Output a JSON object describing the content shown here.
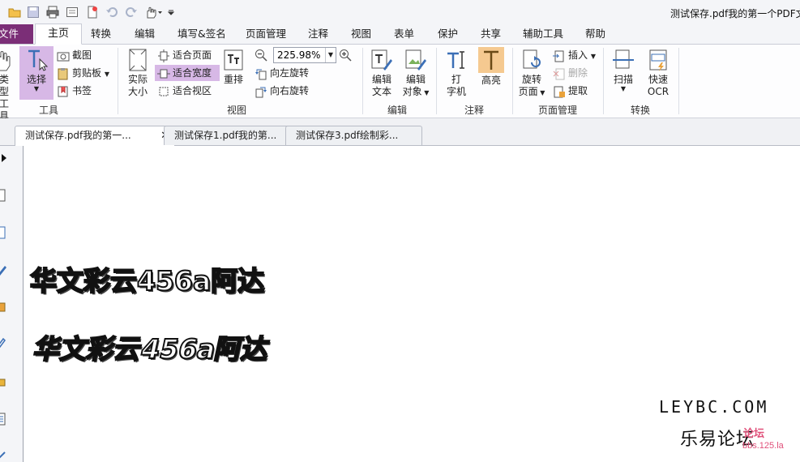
{
  "window": {
    "title": "测试保存.pdf我的第一个PDF文"
  },
  "ribbon_tabs": [
    "文件",
    "主页",
    "转换",
    "编辑",
    "填写&签名",
    "页面管理",
    "注释",
    "视图",
    "表单",
    "保护",
    "共享",
    "辅助工具",
    "帮助"
  ],
  "groups": {
    "tools": {
      "label": "工具",
      "hand_label": [
        "类型",
        "工具"
      ],
      "select_label": "选择",
      "screenshot": "截图",
      "clipboard": "剪贴板",
      "bookmark": "书签"
    },
    "view": {
      "label": "视图",
      "actual_size": [
        "实际",
        "大小"
      ],
      "fit_page": "适合页面",
      "fit_width": "适合宽度",
      "fit_visible": "适合视区",
      "reflow": "重排",
      "zoom_value": "225.98%",
      "rotate_left": "向左旋转",
      "rotate_right": "向右旋转"
    },
    "edit": {
      "label": "编辑",
      "edit_text": [
        "编辑",
        "文本"
      ],
      "edit_object": [
        "编辑",
        "对象"
      ]
    },
    "comment": {
      "label": "注释",
      "typewriter": [
        "打",
        "字机"
      ],
      "highlight": "高亮"
    },
    "page_manage": {
      "label": "页面管理",
      "rotate_page": [
        "旋转",
        "页面"
      ],
      "insert": "插入",
      "delete": "删除",
      "extract": "提取"
    },
    "convert": {
      "label": "转换",
      "scan": "扫描",
      "quick_ocr": [
        "快速",
        "OCR"
      ]
    }
  },
  "doc_tabs": [
    "测试保存.pdf我的第一...",
    "测试保存1.pdf我的第...",
    "测试保存3.pdf绘制彩..."
  ],
  "document": {
    "lines": [
      "华文彩云456a阿达",
      "华文彩云456a阿达"
    ]
  },
  "watermark": {
    "site": "LEYBC.COM",
    "name": "乐易论坛",
    "badge": "论坛",
    "url": "bbs.125.la"
  },
  "colors": {
    "file_tab": "#7b2e77",
    "highlight_bg": "#d7b8e6",
    "watermark_pink": "#e0507a"
  }
}
